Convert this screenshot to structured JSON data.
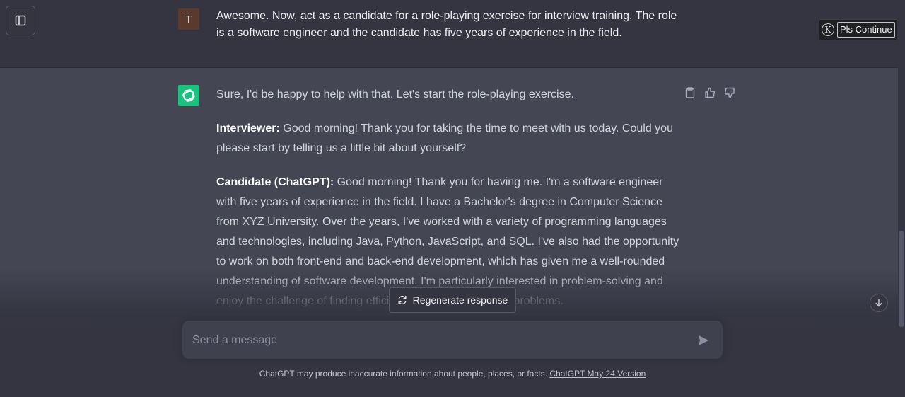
{
  "user_message": {
    "avatar_letter": "T",
    "text": "Awesome. Now, act as a candidate for a role-playing exercise for interview training. The role is a software engineer and the candidate has five years of experience in the field."
  },
  "plugin": {
    "icon_letter": "K",
    "button_label": "Pls Continue"
  },
  "assistant_message": {
    "intro": "Sure, I'd be happy to help with that. Let's start the role-playing exercise.",
    "turns": [
      {
        "speaker": "Interviewer:",
        "text": " Good morning! Thank you for taking the time to meet with us today. Could you please start by telling us a little bit about yourself?"
      },
      {
        "speaker": "Candidate (ChatGPT):",
        "text": " Good morning! Thank you for having me. I'm a software engineer with five years of experience in the field. I have a Bachelor's degree in Computer Science from XYZ University. Over the years, I've worked with a variety of programming languages and technologies, including Java, Python, JavaScript, and SQL. I've also had the opportunity to work on both front-end and back-end development, which has given me a well-rounded understanding of software development. I'm particularly interested in problem-solving and enjoy the challenge of finding efficient solutions to complex problems."
      }
    ]
  },
  "actions": {
    "copy": "clipboard-icon",
    "like": "thumbs-up-icon",
    "dislike": "thumbs-down-icon"
  },
  "regenerate_label": "Regenerate response",
  "composer": {
    "placeholder": "Send a message"
  },
  "footer": {
    "disclaimer": "ChatGPT may produce inaccurate information about people, places, or facts. ",
    "version_link": "ChatGPT May 24 Version"
  },
  "colors": {
    "background": "#343541",
    "assistant_bg": "#444654",
    "gpt_avatar": "#19c37d",
    "user_avatar": "#5b3a2e"
  }
}
